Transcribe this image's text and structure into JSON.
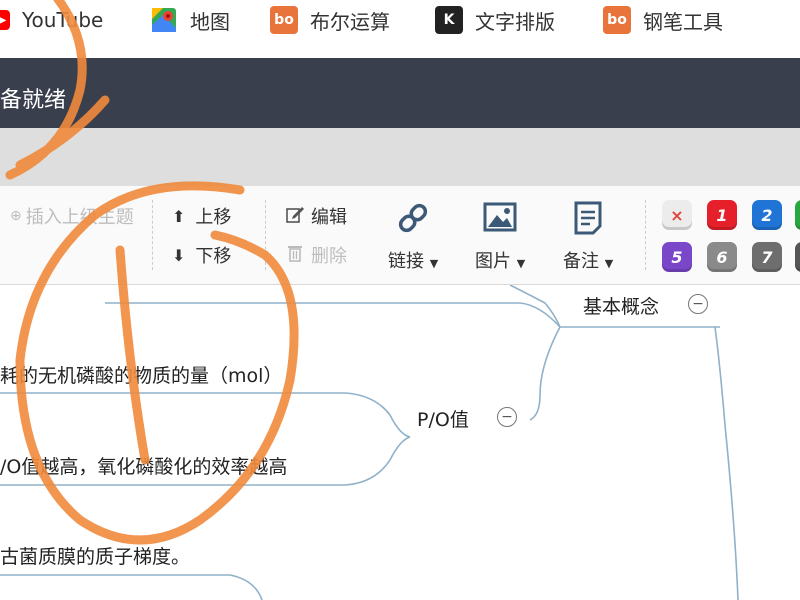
{
  "bookmarks": [
    {
      "icon": "youtube-icon",
      "label": "YouTube",
      "color": "#ff0000"
    },
    {
      "icon": "google-maps-icon",
      "label": "地图"
    },
    {
      "icon": "boardmix-icon",
      "label": "布尔运算",
      "color": "#e8743b"
    },
    {
      "icon": "k-icon",
      "label": "文字排版",
      "color": "#222222"
    },
    {
      "icon": "boardmix-icon",
      "label": "钢笔工具",
      "color": "#e8743b"
    }
  ],
  "status": {
    "text": "备就绪"
  },
  "toolbar": {
    "insert_parent": "插入上级主题",
    "move_up": "上移",
    "move_down": "下移",
    "edit": "编辑",
    "delete": "删除",
    "link": "链接",
    "image": "图片",
    "note": "备注",
    "priorities": [
      {
        "label": "×",
        "color": "#e6e6e6",
        "text_color": "#e0413a"
      },
      {
        "label": "1",
        "color": "#e5202a"
      },
      {
        "label": "2",
        "color": "#1f74d6"
      },
      {
        "label": "5",
        "color": "#7b47c9"
      },
      {
        "label": "6",
        "color": "#8a8a8a"
      },
      {
        "label": "7",
        "color": "#6e6e6e"
      }
    ]
  },
  "mindmap": {
    "node_basic": "基本概念",
    "node_po": "P/O值",
    "text_1": "耗的无机磷酸的物质的量（mol）",
    "text_2": "/O值越高，氧化磷酸化的效率越高",
    "text_3": "古菌质膜的质子梯度。"
  },
  "colors": {
    "status_bar": "#3a3f4d",
    "annotation": "#f08a3c",
    "branch_line": "#8fb1c9"
  }
}
